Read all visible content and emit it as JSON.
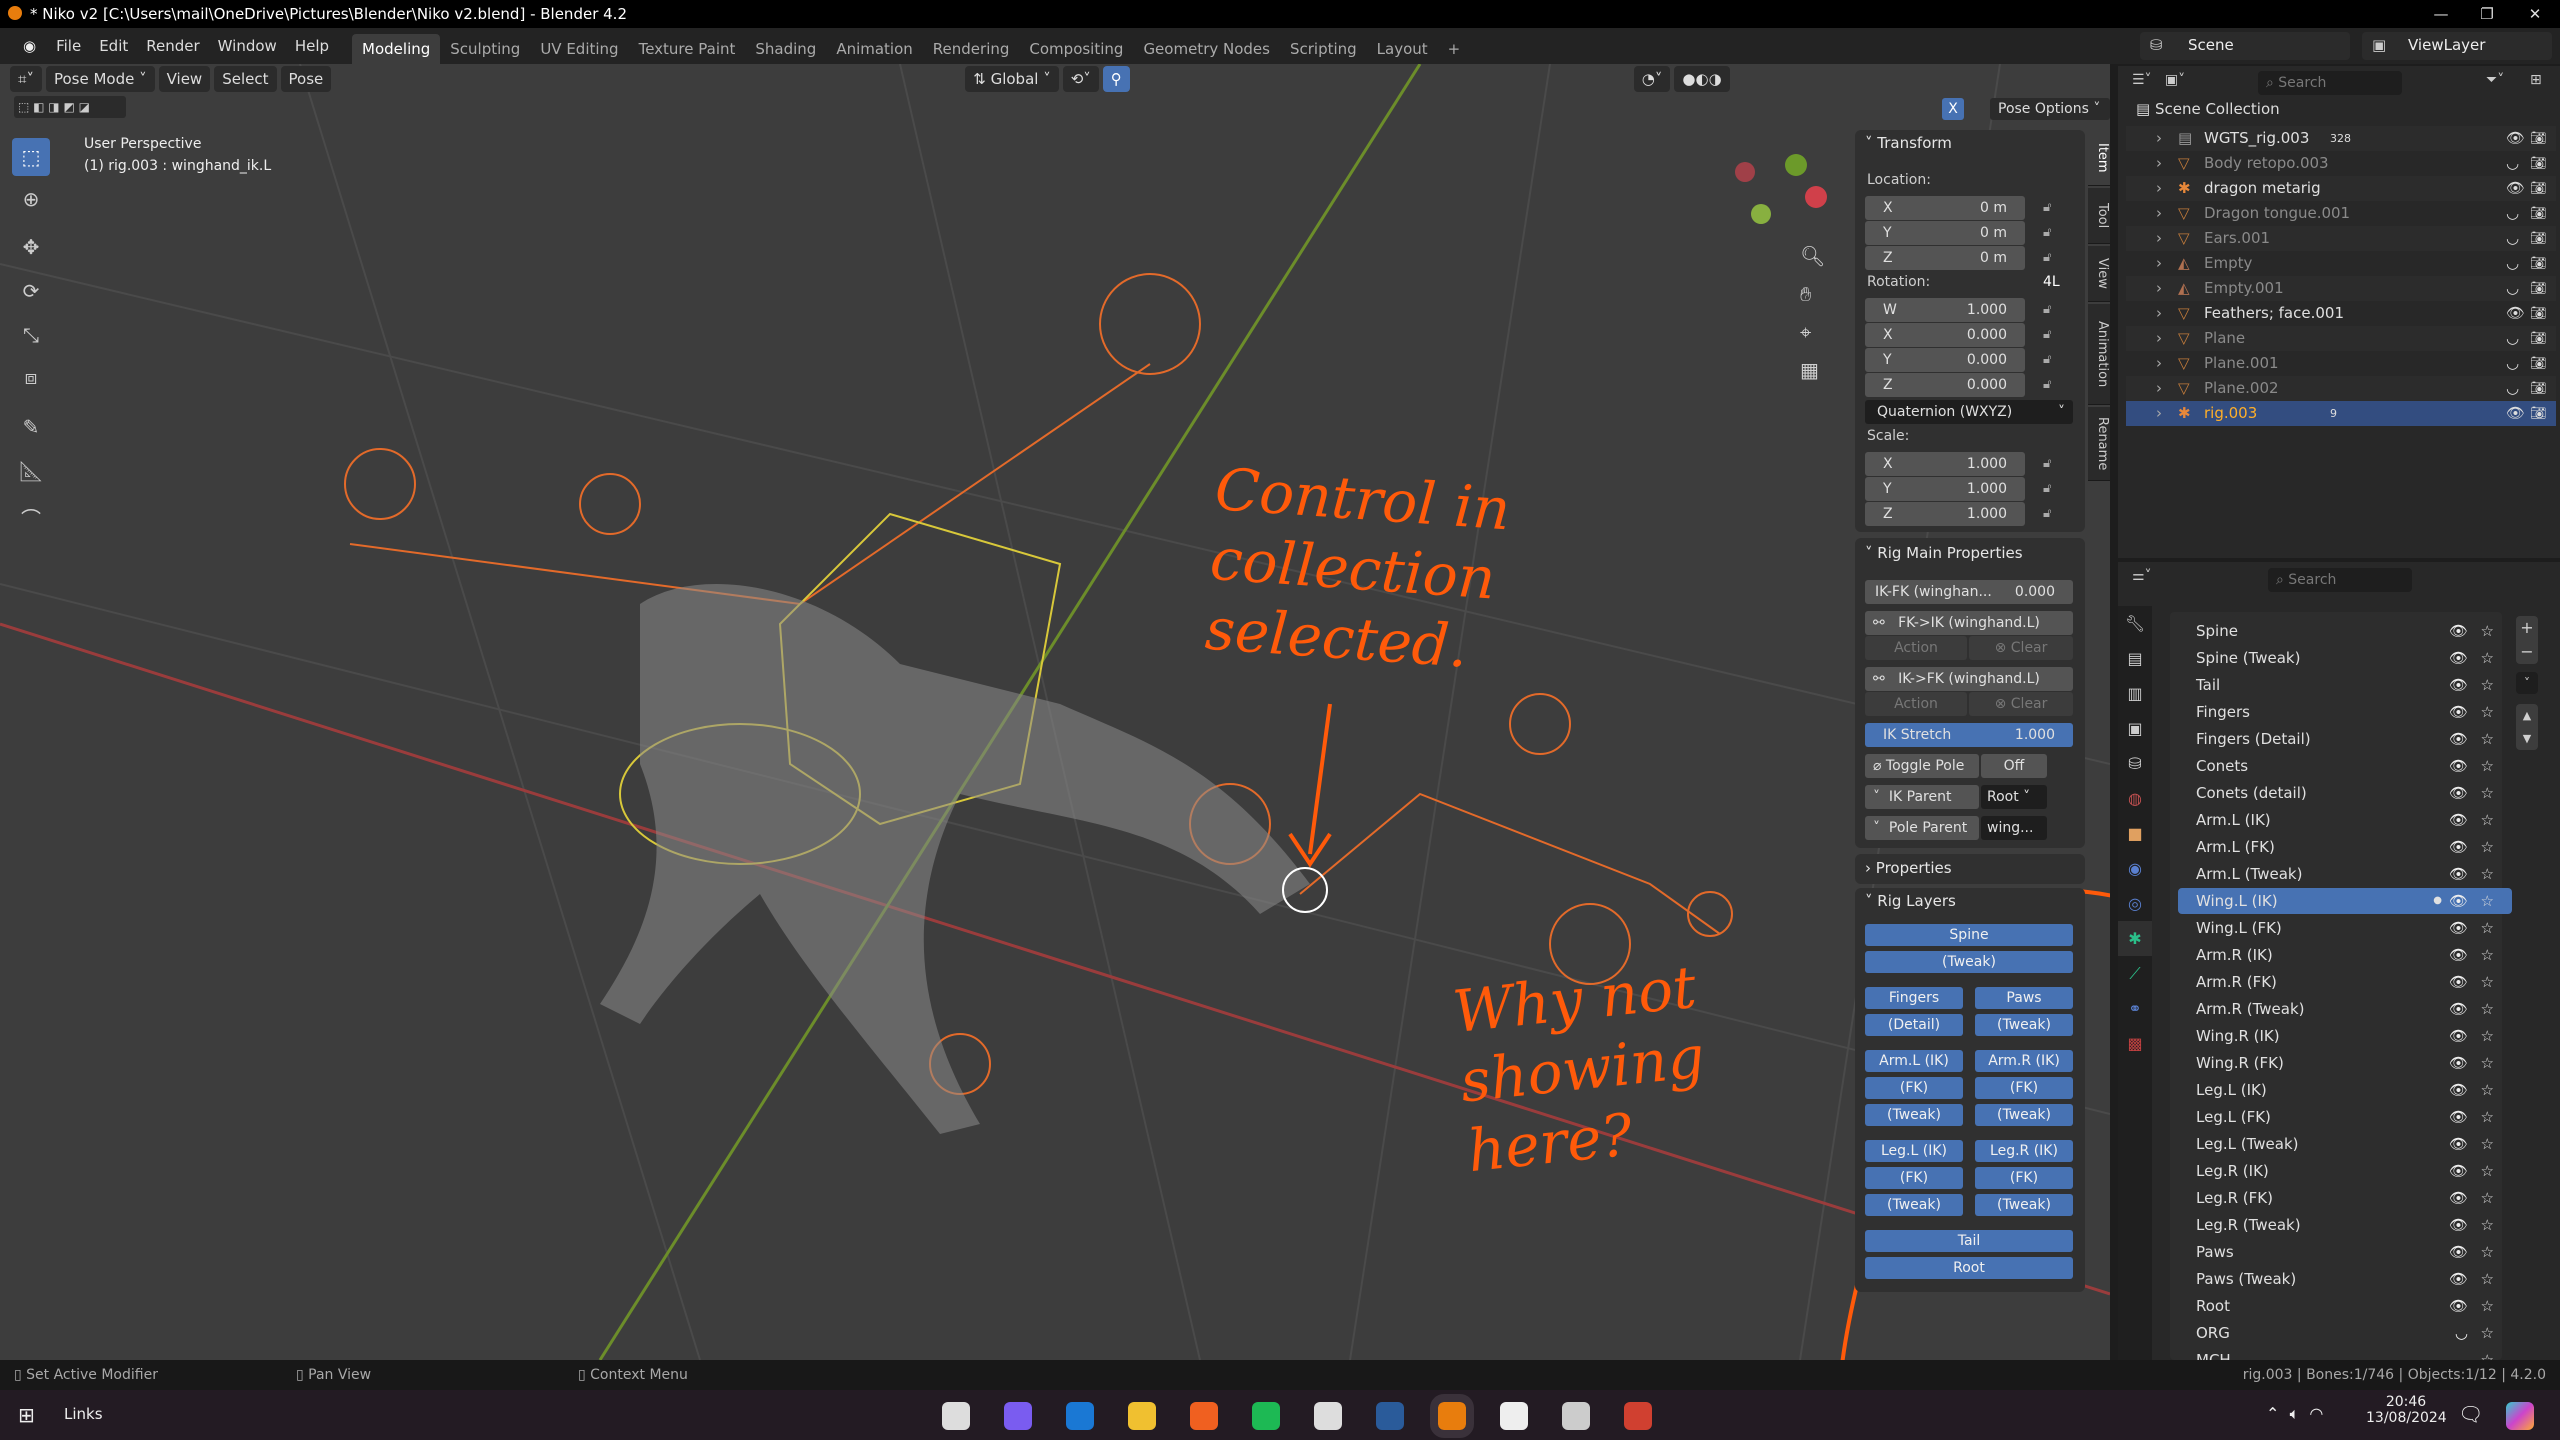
{
  "window": {
    "title": "* Niko v2 [C:\\Users\\mail\\OneDrive\\Pictures\\Blender\\Niko v2.blend] - Blender 4.2"
  },
  "menu": [
    "File",
    "Edit",
    "Render",
    "Window",
    "Help"
  ],
  "workspaces": [
    "Modeling",
    "Sculpting",
    "UV Editing",
    "Texture Paint",
    "Shading",
    "Animation",
    "Rendering",
    "Compositing",
    "Geometry Nodes",
    "Scripting",
    "Layout",
    "+"
  ],
  "active_workspace": "Modeling",
  "viewport_header": {
    "mode": "Pose Mode",
    "menus": [
      "View",
      "Select",
      "Pose"
    ],
    "orientation": "Global",
    "pose_options": "Pose Options",
    "x_mirror": "X"
  },
  "viewport": {
    "perspective": "User Perspective",
    "active": "(1) rig.003 : winghand_ik.L"
  },
  "annotations": [
    "Control in\ncollection\nselected.",
    "Why not\nshowing\nhere?"
  ],
  "npanel_tabs": [
    "Item",
    "Tool",
    "View",
    "Animation",
    "Rename"
  ],
  "transform": {
    "title": "Transform",
    "location_label": "Location:",
    "location": [
      [
        "X",
        "0 m"
      ],
      [
        "Y",
        "0 m"
      ],
      [
        "Z",
        "0 m"
      ]
    ],
    "rotation_label": "Rotation:",
    "rotation_lock": "4L",
    "rotation": [
      [
        "W",
        "1.000"
      ],
      [
        "X",
        "0.000"
      ],
      [
        "Y",
        "0.000"
      ],
      [
        "Z",
        "0.000"
      ]
    ],
    "rotation_mode": "Quaternion (WXYZ)",
    "scale_label": "Scale:",
    "scale": [
      [
        "X",
        "1.000"
      ],
      [
        "Y",
        "1.000"
      ],
      [
        "Z",
        "1.000"
      ]
    ]
  },
  "rig_main": {
    "title": "Rig Main Properties",
    "ikfk_label": "IK-FK (winghan...",
    "ikfk_value": "0.000",
    "fk_ik": "FK->IK (winghand.L)",
    "ik_fk": "IK->FK (winghand.L)",
    "action": "Action",
    "clear": "Clear",
    "ik_stretch_label": "IK Stretch",
    "ik_stretch_value": "1.000",
    "toggle_pole": "Toggle Pole",
    "toggle_pole_value": "Off",
    "ik_parent": "IK Parent",
    "ik_parent_value": "Root",
    "pole_parent": "Pole Parent",
    "pole_parent_value": "wing..."
  },
  "properties_panel": "Properties",
  "rig_layers": {
    "title": "Rig Layers",
    "rows": [
      [
        "Spine"
      ],
      [
        "(Tweak)"
      ],
      null,
      [
        "Fingers",
        "Paws"
      ],
      [
        "(Detail)",
        "(Tweak)"
      ],
      null,
      [
        "Arm.L (IK)",
        "Arm.R (IK)"
      ],
      [
        "(FK)",
        "(FK)"
      ],
      [
        "(Tweak)",
        "(Tweak)"
      ],
      null,
      [
        "Leg.L (IK)",
        "Leg.R (IK)"
      ],
      [
        "(FK)",
        "(FK)"
      ],
      [
        "(Tweak)",
        "(Tweak)"
      ],
      null,
      [
        "Tail"
      ],
      [
        "Root"
      ]
    ]
  },
  "topbar_right": {
    "scene": "Scene",
    "view_layer": "ViewLayer"
  },
  "outliner": {
    "search_placeholder": "Search",
    "root": "Scene Collection",
    "items": [
      {
        "name": "WGTS_rig.003",
        "type": "collection",
        "badge": "328",
        "visible": true
      },
      {
        "name": "Body retopo.003",
        "type": "mesh",
        "visible": false
      },
      {
        "name": "dragon metarig",
        "type": "armature",
        "visible": true
      },
      {
        "name": "Dragon tongue.001",
        "type": "mesh",
        "visible": false
      },
      {
        "name": "Ears.001",
        "type": "mesh",
        "visible": false
      },
      {
        "name": "Empty",
        "type": "empty",
        "visible": false
      },
      {
        "name": "Empty.001",
        "type": "empty",
        "visible": false
      },
      {
        "name": "Feathers; face.001",
        "type": "mesh",
        "visible": true
      },
      {
        "name": "Plane",
        "type": "mesh",
        "visible": false
      },
      {
        "name": "Plane.001",
        "type": "mesh",
        "visible": false
      },
      {
        "name": "Plane.002",
        "type": "mesh",
        "visible": false
      },
      {
        "name": "rig.003",
        "type": "armature",
        "badge": "9",
        "visible": true,
        "selected": true
      }
    ]
  },
  "bone_collections": {
    "search_placeholder": "Search",
    "items": [
      "Spine",
      "Spine (Tweak)",
      "Tail",
      "Fingers",
      "Fingers (Detail)",
      "Conets",
      "Conets (detail)",
      "Arm.L (IK)",
      "Arm.L (FK)",
      "Arm.L (Tweak)",
      "Wing.L (IK)",
      "Wing.L (FK)",
      "Arm.R (IK)",
      "Arm.R (FK)",
      "Arm.R (Tweak)",
      "Wing.R (IK)",
      "Wing.R (FK)",
      "Leg.L (IK)",
      "Leg.L (FK)",
      "Leg.L (Tweak)",
      "Leg.R (IK)",
      "Leg.R (FK)",
      "Leg.R (Tweak)",
      "Paws",
      "Paws (Tweak)",
      "Root",
      "ORG",
      "MCH"
    ],
    "active": "Wing.L (IK)",
    "hidden": [
      "ORG",
      "MCH"
    ]
  },
  "status": {
    "left": [
      "Set Active Modifier",
      "Pan View",
      "Context Menu"
    ],
    "right": "rig.003 | Bones:1/746 | Objects:1/12 | 4.2.0"
  },
  "taskbar": {
    "links": "Links",
    "time": "20:46",
    "date": "13/08/2024"
  },
  "colors": {
    "accent": "#4772b3",
    "annotation": "#ff5a0a",
    "selection_orange": "#e87d0d"
  }
}
